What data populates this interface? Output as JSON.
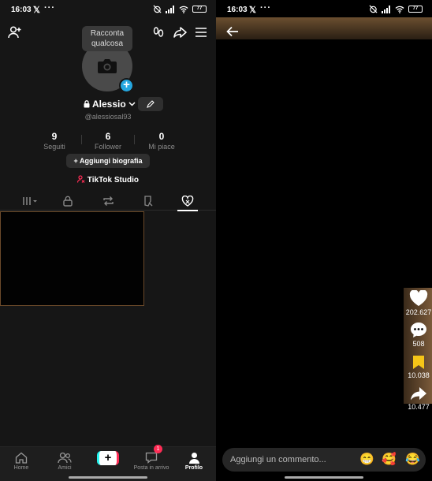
{
  "status": {
    "time": "16:03",
    "x_mark": "𝕏",
    "dots": "···",
    "battery": "77"
  },
  "profile": {
    "tooltip": "Racconta qualcosa",
    "name": "Alessio",
    "handle": "@alessiosal93",
    "stats": [
      {
        "value": "9",
        "label": "Seguiti"
      },
      {
        "value": "6",
        "label": "Follower"
      },
      {
        "value": "0",
        "label": "Mi piace"
      }
    ],
    "bio_button": "+ Aggiungi biografia",
    "studio": "TikTok Studio"
  },
  "nav": {
    "home": "Home",
    "friends": "Amici",
    "create": "+",
    "inbox": "Posta in arrivo",
    "inbox_badge": "1",
    "profile": "Profilo"
  },
  "video": {
    "likes": "202.627",
    "comments": "508",
    "saves": "10.038",
    "shares": "10.477",
    "comment_placeholder": "Aggiungi un commento...",
    "emojis": [
      "😁",
      "🥰",
      "😂"
    ]
  },
  "colors": {
    "accent_red": "#fe2c55",
    "accent_cyan": "#25f4ee",
    "save_yellow": "#f5c518",
    "add_blue": "#25a7e0"
  }
}
